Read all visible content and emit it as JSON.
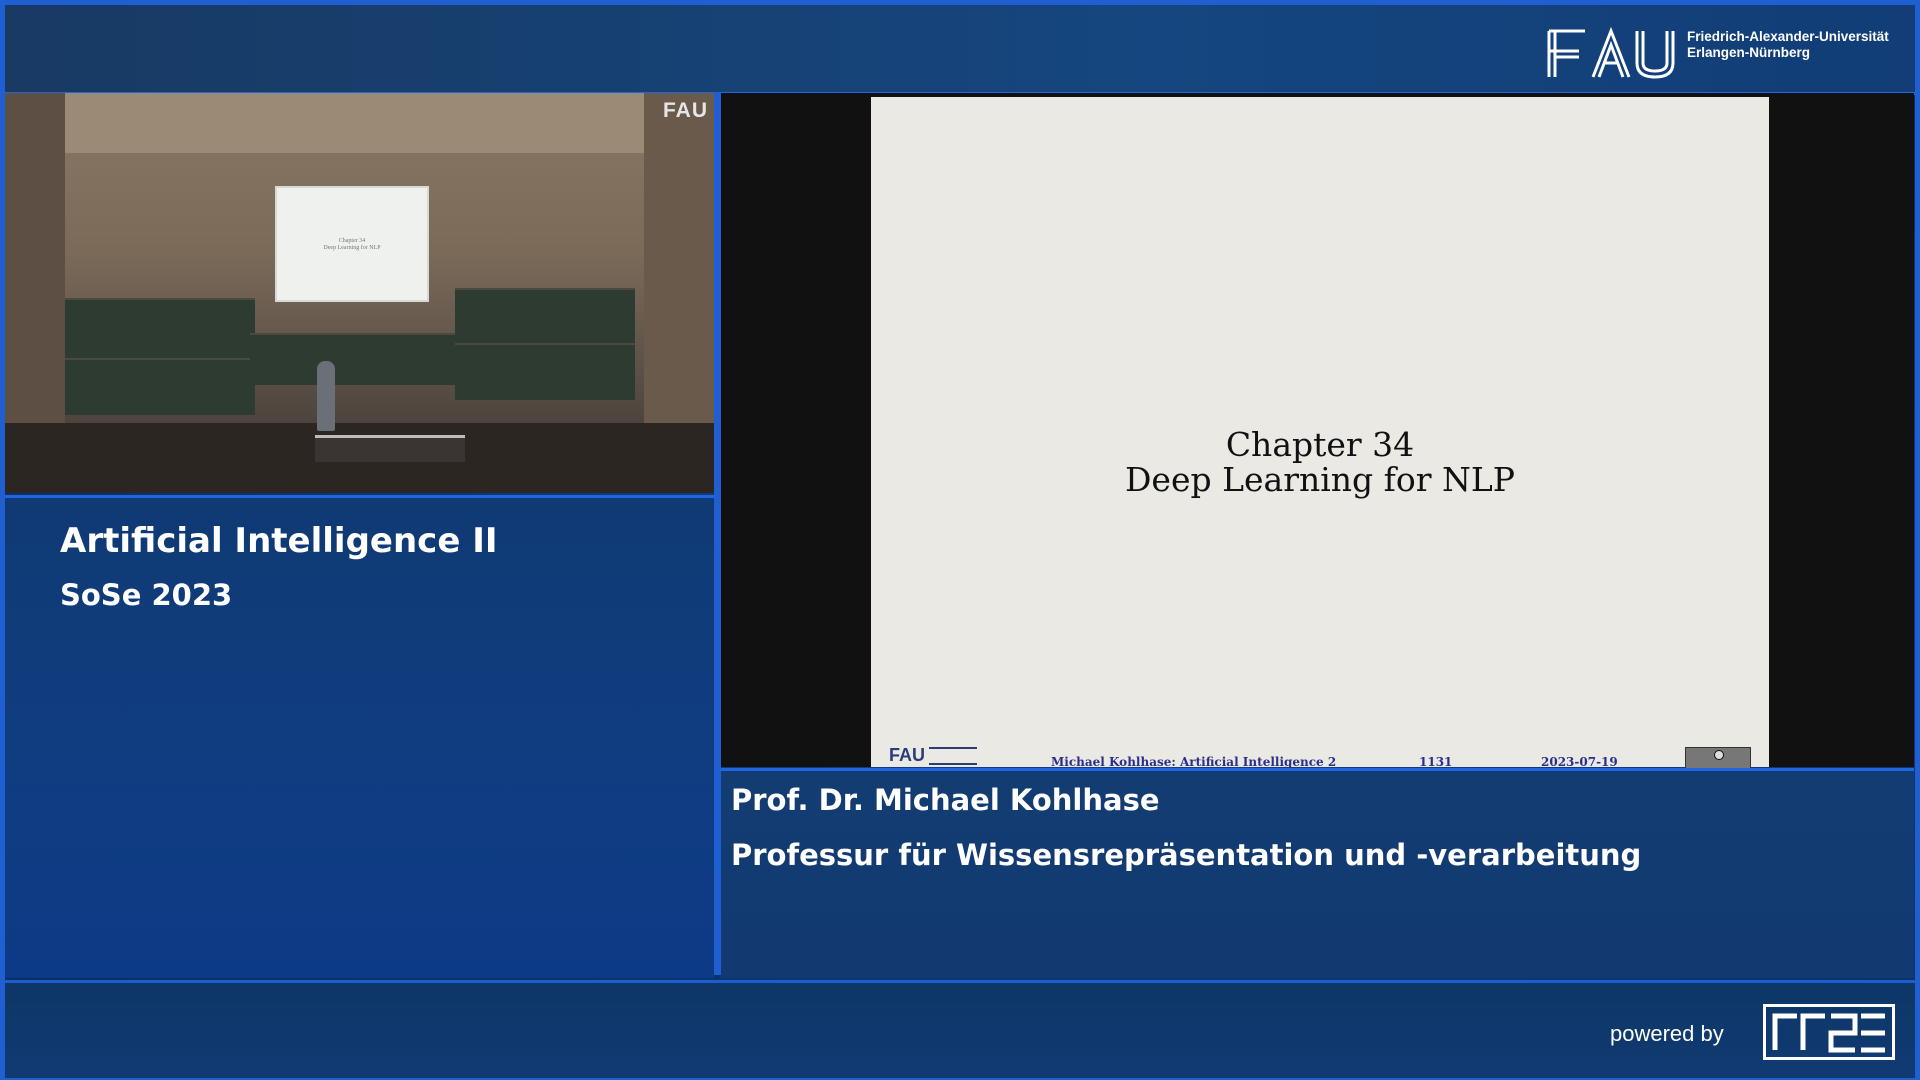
{
  "header": {
    "logo_text": "FAU",
    "university_line1": "Friedrich-Alexander-Universität",
    "university_line2": "Erlangen-Nürnberg"
  },
  "camera": {
    "watermark": "FAU",
    "screen_text_line1": "Chapter 34",
    "screen_text_line2": "Deep Learning for NLP"
  },
  "course": {
    "title": "Artificial Intelligence II",
    "term": "SoSe 2023"
  },
  "slide": {
    "heading_line1": "Chapter 34",
    "heading_line2": "Deep Learning for NLP",
    "footer_logo": "FAU",
    "footer_author": "Michael Kohlhase: Artificial Intelligence 2",
    "footer_page": "1131",
    "footer_date": "2023-07-19"
  },
  "speaker": {
    "name": "Prof. Dr. Michael Kohlhase",
    "department": "Professur für Wissensrepräsentation und -verarbeitung"
  },
  "footer": {
    "powered_by": "powered by",
    "brand_logo_text": "RRZE"
  },
  "colors": {
    "accent_blue": "#1f5fd1",
    "background_navy": "#0f3573"
  }
}
